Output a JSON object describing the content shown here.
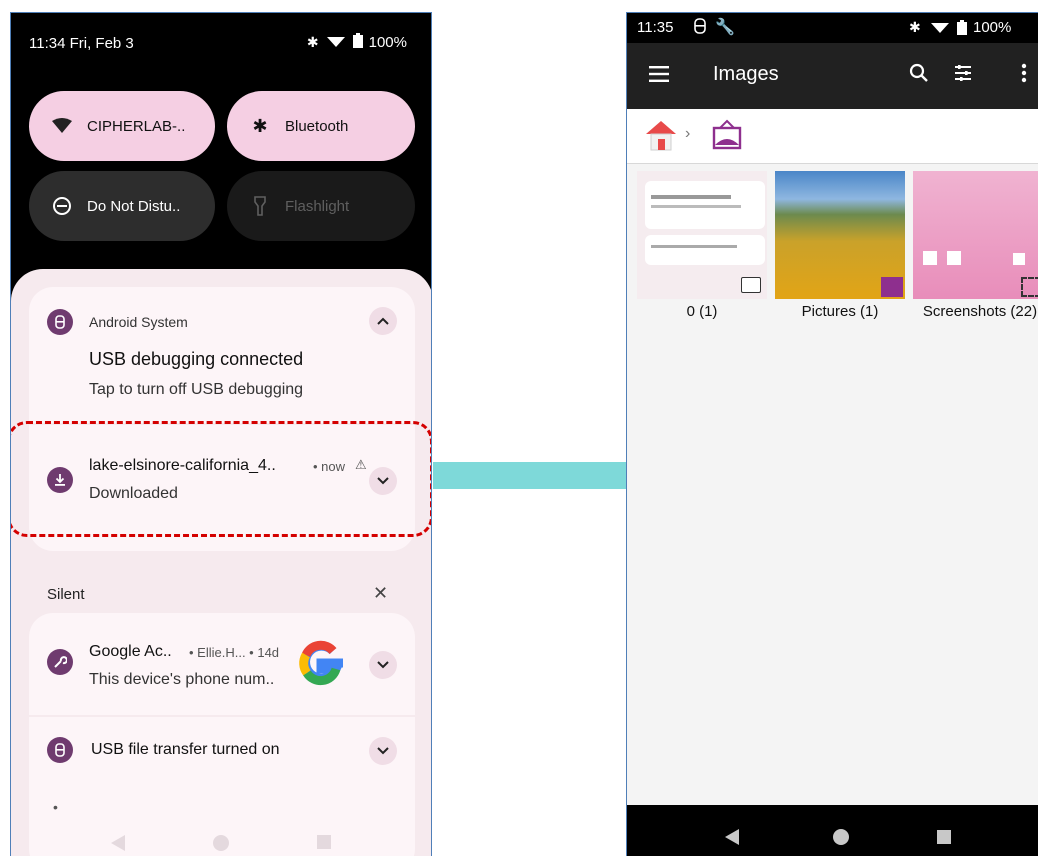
{
  "left_phone": {
    "status_time": "11:34 Fri, Feb 3",
    "status_battery": "100%",
    "quick_tiles": [
      {
        "label": "CIPHERLAB-..",
        "icon": "wifi-icon",
        "state": "on"
      },
      {
        "label": "Bluetooth",
        "icon": "bluetooth-icon",
        "state": "on"
      },
      {
        "label": "Do Not Distu..",
        "icon": "do-not-disturb-icon",
        "state": "off"
      },
      {
        "label": "Flashlight",
        "icon": "flashlight-icon",
        "state": "unavailable"
      }
    ],
    "notifications": {
      "usb_debug": {
        "app": "Android System",
        "title": "USB debugging connected",
        "body": "Tap to turn off USB debugging"
      },
      "download": {
        "title": "lake-elsinore-california_4..",
        "meta": "• now",
        "body": "Downloaded"
      },
      "silent_header": "Silent",
      "google": {
        "title": "Google Ac..",
        "meta": "• Ellie.H... • 14d",
        "body": "This device's phone num.."
      },
      "usb_transfer": {
        "title": "USB file transfer turned on"
      },
      "dot": "•"
    }
  },
  "right_phone": {
    "status_time": "11:35",
    "status_battery": "100%",
    "toolbar_title": "Images",
    "folders": [
      {
        "label": "0 (1)"
      },
      {
        "label": "Pictures (1)"
      },
      {
        "label": "Screenshots (22)"
      }
    ]
  },
  "colors": {
    "accent_pink": "#f5cfe3",
    "badge_purple": "#6f3b6f",
    "highlight_red": "#d40000",
    "arrow_teal": "#7ed9d9",
    "toolbar_dark": "#212121"
  }
}
